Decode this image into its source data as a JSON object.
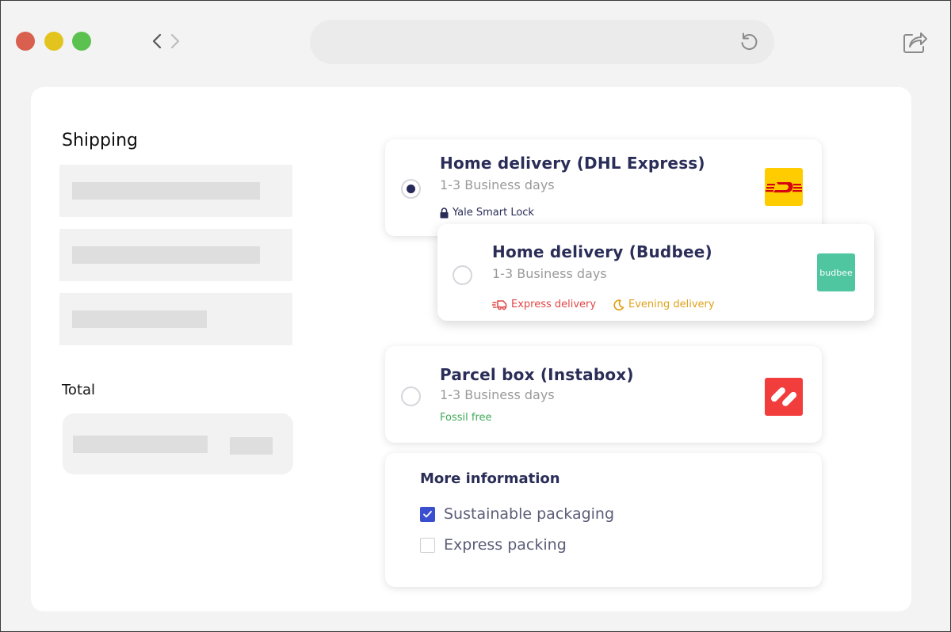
{
  "window": {
    "controls": [
      "close",
      "minimize",
      "maximize"
    ],
    "colors": {
      "close": "#d9604f",
      "minimize": "#e3c41f",
      "maximize": "#5cc24f"
    },
    "icons": {
      "back": "chevron-left-icon",
      "forward": "chevron-right-icon",
      "reload": "reload-icon",
      "share": "share-icon"
    }
  },
  "sidebar": {
    "shipping_heading": "Shipping",
    "total_heading": "Total"
  },
  "options": [
    {
      "title": "Home delivery (DHL Express)",
      "subtitle": "1-3 Business days",
      "selected": true,
      "tags": [
        {
          "text": "Yale Smart Lock",
          "icon": "lock-icon",
          "color": "#2a2d57"
        }
      ],
      "logo": {
        "name": "dhl-logo",
        "bg": "#ffcc00",
        "fg": "#d40511"
      }
    },
    {
      "title": "Home delivery (Budbee)",
      "subtitle": "1-3 Business days",
      "selected": false,
      "tags": [
        {
          "text": "Express delivery",
          "icon": "fast-delivery-icon",
          "color": "#e04545"
        },
        {
          "text": "Evening delivery",
          "icon": "moon-icon",
          "color": "#e0a21b"
        }
      ],
      "logo": {
        "name": "budbee-logo",
        "text": "budbee",
        "bg": "#4fc6a0",
        "fg": "#ffffff"
      }
    },
    {
      "title": "Parcel box (Instabox)",
      "subtitle": "1-3 Business days",
      "selected": false,
      "tags": [
        {
          "text": "Fossil free",
          "icon": "",
          "color": "#3fa957"
        }
      ],
      "logo": {
        "name": "instabox-logo",
        "bg": "#f23d3d",
        "fg": "#ffffff"
      }
    }
  ],
  "more_info": {
    "title": "More information",
    "checkboxes": [
      {
        "label": "Sustainable packaging",
        "checked": true
      },
      {
        "label": "Express packing",
        "checked": false
      }
    ]
  }
}
